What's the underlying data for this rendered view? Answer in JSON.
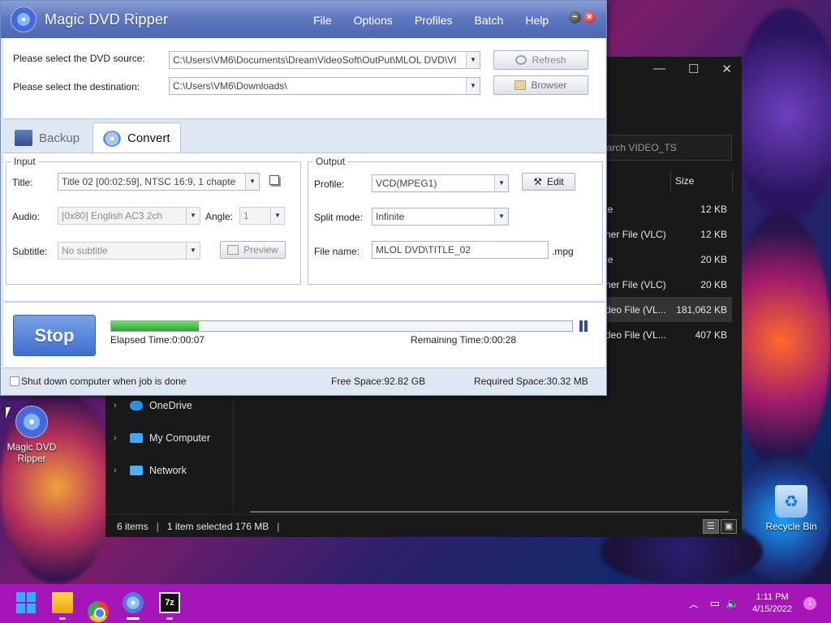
{
  "app": {
    "title": "Magic DVD Ripper",
    "menu": [
      "File",
      "Options",
      "Profiles",
      "Batch",
      "Help"
    ],
    "minimize": "−",
    "close": "×"
  },
  "source": {
    "dvd_label": "Please select the DVD source:",
    "dvd_value": "C:\\Users\\VM6\\Documents\\DreamVideoSoft\\OutPut\\MLOL DVD\\VI",
    "dest_label": "Please select the destination:",
    "dest_value": "C:\\Users\\VM6\\Downloads\\",
    "refresh_label": "Refresh",
    "browser_label": "Browser"
  },
  "tabs": [
    {
      "label": "Backup",
      "icon": "backup-icon"
    },
    {
      "label": "Convert",
      "icon": "convert-icon",
      "active": true
    }
  ],
  "input": {
    "group_title": "Input",
    "title_label": "Title:",
    "title_value": "Title 02 [00:02:59], NTSC 16:9, 1 chapte",
    "audio_label": "Audio:",
    "audio_value": "[0x80] English AC3 2ch",
    "angle_label": "Angle:",
    "angle_value": "1",
    "subtitle_label": "Subtitle:",
    "subtitle_value": "No subtitle",
    "preview_label": "Preview"
  },
  "output": {
    "group_title": "Output",
    "profile_label": "Profile:",
    "profile_value": "VCD(MPEG1)",
    "edit_label": "Edit",
    "split_label": "Split mode:",
    "split_value": "Infinite",
    "filename_label": "File name:",
    "filename_value": "MLOL DVD\\TITLE_02",
    "ext": ".mpg"
  },
  "progress": {
    "stop_label": "Stop",
    "percent": 19,
    "elapsed": "Elapsed Time:0:00:07",
    "remaining": "Remaining Time:0:00:28"
  },
  "status": {
    "shutdown_label": "Shut down computer when job is done",
    "free_space": "Free Space:92.82 GB",
    "required_space": "Required Space:30.32 MB"
  },
  "explorer": {
    "search_placeholder": "earch VIDEO_TS",
    "size_header": "Size",
    "rows": [
      {
        "name": "le",
        "size": "12 KB"
      },
      {
        "name": "her File (VLC)",
        "size": "12 KB"
      },
      {
        "name": "le",
        "size": "20 KB"
      },
      {
        "name": "her File (VLC)",
        "size": "20 KB"
      },
      {
        "name": "deo File (VL...",
        "size": "181,062 KB",
        "selected": true
      },
      {
        "name": "deo File (VL...",
        "size": "407 KB"
      }
    ],
    "nav": [
      "OneDrive",
      "My Computer",
      "Network"
    ],
    "status_items": "6 items",
    "status_selected": "1 item selected  176 MB"
  },
  "desktop": {
    "icons": [
      {
        "label": "Magic DVD Ripper"
      },
      {
        "label": "Recycle Bin"
      }
    ]
  },
  "taskbar": {
    "seven_zip": "7z",
    "time": "1:11 PM",
    "date": "4/15/2022",
    "notifications": "1"
  }
}
